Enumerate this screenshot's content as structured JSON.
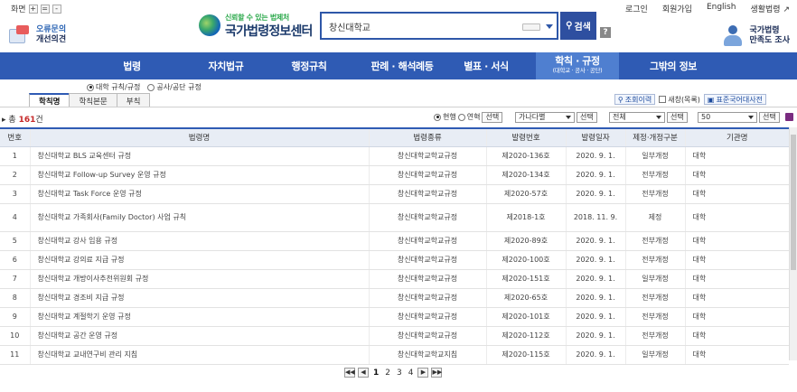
{
  "topbar": {
    "zoom_label": "화면",
    "zoom_in": "+",
    "zoom_reset": "=",
    "zoom_out": "-",
    "links": [
      "로그인",
      "회원가입",
      "English",
      "생활법령"
    ]
  },
  "header": {
    "left_side": {
      "line1": "오류문의",
      "line2": "개선의견"
    },
    "logo_slogan": "신뢰할 수 있는 법제처",
    "logo_name": "국가법령정보센터",
    "search_value": "창신대학교",
    "search_button": "검색",
    "help_button": "?",
    "right_side": {
      "line1": "국가법령",
      "line2": "만족도 조사"
    }
  },
  "nav": {
    "items": [
      "법령",
      "자치법규",
      "행정규칙",
      "판례 · 해석례등",
      "별표 · 서식"
    ],
    "active": {
      "label": "학칙 · 규정",
      "sub": "(대학교 · 공사 · 공단)"
    },
    "last": "그밖의 정보"
  },
  "filters": {
    "radio1": "대학 규칙/규정",
    "radio2": "공사/공단 규정"
  },
  "tabs": [
    "학칙명",
    "학칙본문",
    "부칙"
  ],
  "tools": {
    "search_in_results": "조회이력",
    "new_window": "새창(목록)",
    "standard_dict": "표준국어대사전"
  },
  "result": {
    "count_prefix": "총",
    "count": "161",
    "count_suffix": "건",
    "current": "현행",
    "history": "연혁",
    "select": "선택",
    "sort_value": "가나다별",
    "filter_value": "전체",
    "page_size": "50"
  },
  "table": {
    "headers": [
      "번호",
      "법령명",
      "법령종류",
      "발령번호",
      "발령일자",
      "제정·개정구분",
      "기관명"
    ],
    "rows": [
      {
        "no": "1",
        "name": "창신대학교 BLS 교육센터 규정",
        "type": "창신대학교학교규정",
        "num": "제2020-136호",
        "date": "2020. 9. 1.",
        "kind": "일부개정",
        "org": "대학"
      },
      {
        "no": "2",
        "name": "창신대학교 Follow-up Survey 운영 규정",
        "type": "창신대학교학교규정",
        "num": "제2020-134호",
        "date": "2020. 9. 1.",
        "kind": "전부개정",
        "org": "대학"
      },
      {
        "no": "3",
        "name": "창신대학교 Task Force 운영 규정",
        "type": "창신대학교학교규정",
        "num": "제2020-57호",
        "date": "2020. 9. 1.",
        "kind": "전부개정",
        "org": "대학"
      },
      {
        "no": "4",
        "name": "창신대학교 가족회사(Family Doctor) 사업 규칙",
        "type": "창신대학교학교규정",
        "num": "제2018-1호",
        "date": "2018. 11. 9.",
        "kind": "제정",
        "org": "대학"
      },
      {
        "no": "5",
        "name": "창신대학교 강사 임용 규정",
        "type": "창신대학교학교규정",
        "num": "제2020-89호",
        "date": "2020. 9. 1.",
        "kind": "전부개정",
        "org": "대학"
      },
      {
        "no": "6",
        "name": "창신대학교 강의료 지급 규정",
        "type": "창신대학교학교규정",
        "num": "제2020-100호",
        "date": "2020. 9. 1.",
        "kind": "전부개정",
        "org": "대학"
      },
      {
        "no": "7",
        "name": "창신대학교 개방이사추천위원회 규정",
        "type": "창신대학교학교규정",
        "num": "제2020-151호",
        "date": "2020. 9. 1.",
        "kind": "일부개정",
        "org": "대학"
      },
      {
        "no": "8",
        "name": "창신대학교 경조비 지급 규정",
        "type": "창신대학교학교규정",
        "num": "제2020-65호",
        "date": "2020. 9. 1.",
        "kind": "전부개정",
        "org": "대학"
      },
      {
        "no": "9",
        "name": "창신대학교 계절학기 운영 규정",
        "type": "창신대학교학교규정",
        "num": "제2020-101호",
        "date": "2020. 9. 1.",
        "kind": "전부개정",
        "org": "대학"
      },
      {
        "no": "10",
        "name": "창신대학교 공간 운영 규정",
        "type": "창신대학교학교규정",
        "num": "제2020-112호",
        "date": "2020. 9. 1.",
        "kind": "전부개정",
        "org": "대학"
      },
      {
        "no": "11",
        "name": "창신대학교 교내연구비 관리 지침",
        "type": "창신대학교학교지침",
        "num": "제2020-115호",
        "date": "2020. 9. 1.",
        "kind": "일부개정",
        "org": "대학"
      }
    ]
  },
  "pager": {
    "first": "◀◀",
    "prev": "◀",
    "pages": [
      "1",
      "2",
      "3",
      "4"
    ],
    "next": "▶",
    "last": "▶▶"
  }
}
